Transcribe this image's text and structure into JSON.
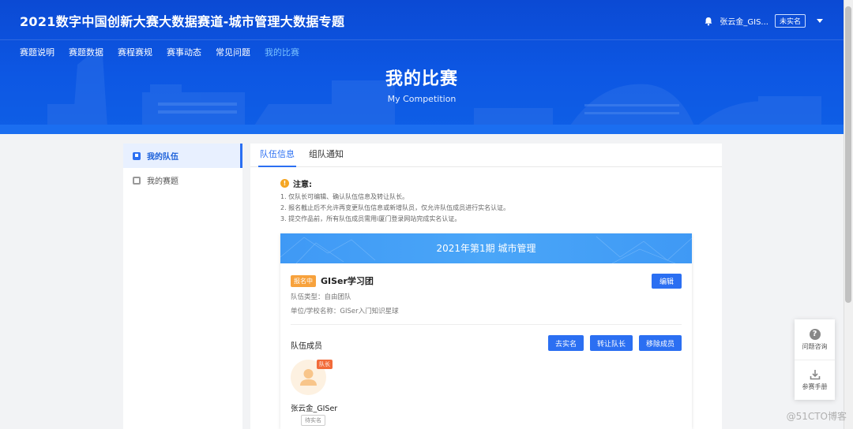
{
  "header": {
    "site_title": "2021数字中国创新大赛大数据赛道-城市管理大数据专题",
    "user_name": "张云金_GIS...",
    "user_badge": "未实名",
    "banner_title": "我的比赛",
    "banner_subtitle": "My Competition"
  },
  "nav": {
    "items": [
      "赛题说明",
      "赛题数据",
      "赛程赛规",
      "赛事动态",
      "常见问题",
      "我的比赛"
    ],
    "active_index": 5
  },
  "sidebar": {
    "items": [
      {
        "label": "我的队伍",
        "active": true
      },
      {
        "label": "我的赛题",
        "active": false
      }
    ]
  },
  "tabs": {
    "items": [
      "队伍信息",
      "组队通知"
    ],
    "active_index": 0
  },
  "notice": {
    "title": "注意:",
    "lines": [
      "1. 仅队长可编辑、确认队伍信息及转让队长。",
      "2. 报名截止后不允许再变更队伍信息或新增队员，仅允许队伍成员进行实名认证。",
      "3. 提交作品前，所有队伍成员需用i厦门登录网站完成实名认证。"
    ]
  },
  "team_card": {
    "header": "2021年第1期 城市管理",
    "status_tag": "报名中",
    "team_name": "GISer学习团",
    "edit_label": "编辑",
    "team_type": "队伍类型：自由团队",
    "org_name": "单位/学校名称：GISer入门知识星球",
    "members_title": "队伍成员",
    "member_buttons": [
      "去实名",
      "转让队长",
      "移除成员"
    ],
    "member": {
      "leader_tag": "队长",
      "name": "张云金_GISer",
      "status": "待实名"
    }
  },
  "float_help": {
    "consult_label": "问题咨询",
    "manual_label": "参赛手册"
  },
  "watermark": "@51CTO博客",
  "colors": {
    "primary": "#2b6ff2",
    "header_bg": "#0a4fd6",
    "card_header": "#3f99f5",
    "status_tag": "#f7a23d",
    "leader_tag": "#f26b3a"
  }
}
